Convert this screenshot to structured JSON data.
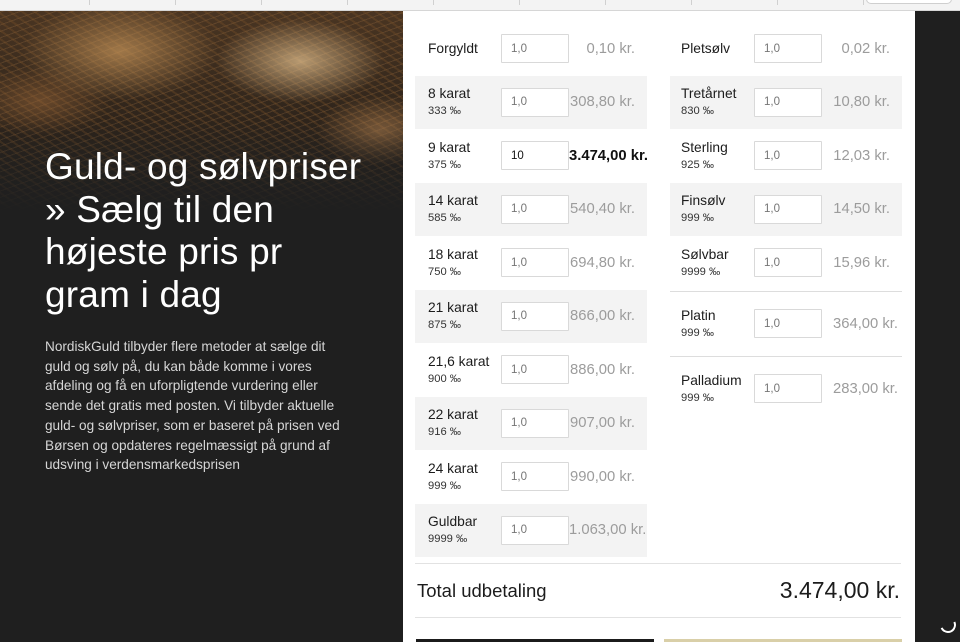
{
  "hero": {
    "title": "Guld- og sølvpriser » Sælg til den højeste pris pr gram i dag",
    "description": "NordiskGuld tilbyder flere metoder at sælge dit guld og sølv på, du kan både komme i vores afdeling og få en uforpligtende vurdering eller sende det gratis med posten. Vi tilbyder aktuelle guld- og sølvpriser, som er baseret på prisen ved Børsen og opdateres regelmæssigt på grund af udsving i verdensmarkedsprisen"
  },
  "gold": {
    "items": [
      {
        "name": "Forgyldt",
        "fineness": "",
        "placeholder": "1,0",
        "value": "",
        "price": "0,10 kr."
      },
      {
        "name": "8 karat",
        "fineness": "333 ‰",
        "placeholder": "1,0",
        "value": "",
        "price": "308,80 kr."
      },
      {
        "name": "9 karat",
        "fineness": "375 ‰",
        "placeholder": "1,0",
        "value": "10",
        "price": "3.474,00 kr."
      },
      {
        "name": "14 karat",
        "fineness": "585 ‰",
        "placeholder": "1,0",
        "value": "",
        "price": "540,40 kr."
      },
      {
        "name": "18 karat",
        "fineness": "750 ‰",
        "placeholder": "1,0",
        "value": "",
        "price": "694,80 kr."
      },
      {
        "name": "21 karat",
        "fineness": "875 ‰",
        "placeholder": "1,0",
        "value": "",
        "price": "866,00 kr."
      },
      {
        "name": "21,6 karat",
        "fineness": "900 ‰",
        "placeholder": "1,0",
        "value": "",
        "price": "886,00 kr."
      },
      {
        "name": "22 karat",
        "fineness": "916 ‰",
        "placeholder": "1,0",
        "value": "",
        "price": "907,00 kr."
      },
      {
        "name": "24 karat",
        "fineness": "999 ‰",
        "placeholder": "1,0",
        "value": "",
        "price": "990,00 kr."
      },
      {
        "name": "Guldbar",
        "fineness": "9999 ‰",
        "placeholder": "1,0",
        "value": "",
        "price": "1.063,00 kr."
      }
    ]
  },
  "silver": {
    "items": [
      {
        "name": "Pletsølv",
        "fineness": "",
        "placeholder": "1,0",
        "value": "",
        "price": "0,02 kr."
      },
      {
        "name": "Tretårnet",
        "fineness": "830 ‰",
        "placeholder": "1,0",
        "value": "",
        "price": "10,80 kr."
      },
      {
        "name": "Sterling",
        "fineness": "925 ‰",
        "placeholder": "1,0",
        "value": "",
        "price": "12,03 kr."
      },
      {
        "name": "Finsølv",
        "fineness": "999 ‰",
        "placeholder": "1,0",
        "value": "",
        "price": "14,50 kr."
      },
      {
        "name": "Sølvbar",
        "fineness": "9999 ‰",
        "placeholder": "1,0",
        "value": "",
        "price": "15,96 kr."
      }
    ]
  },
  "other": {
    "items": [
      {
        "name": "Platin",
        "fineness": "999 ‰",
        "placeholder": "1,0",
        "value": "",
        "price": "364,00 kr."
      },
      {
        "name": "Palladium",
        "fineness": "999 ‰",
        "placeholder": "1,0",
        "value": "",
        "price": "283,00 kr."
      }
    ]
  },
  "total": {
    "label": "Total udbetaling",
    "value": "3.474,00 kr."
  },
  "colors": {
    "background": "#1f1f1f",
    "panel": "#ffffff",
    "row_shade": "#f3f3f3",
    "price_muted": "#9c9c9c"
  }
}
